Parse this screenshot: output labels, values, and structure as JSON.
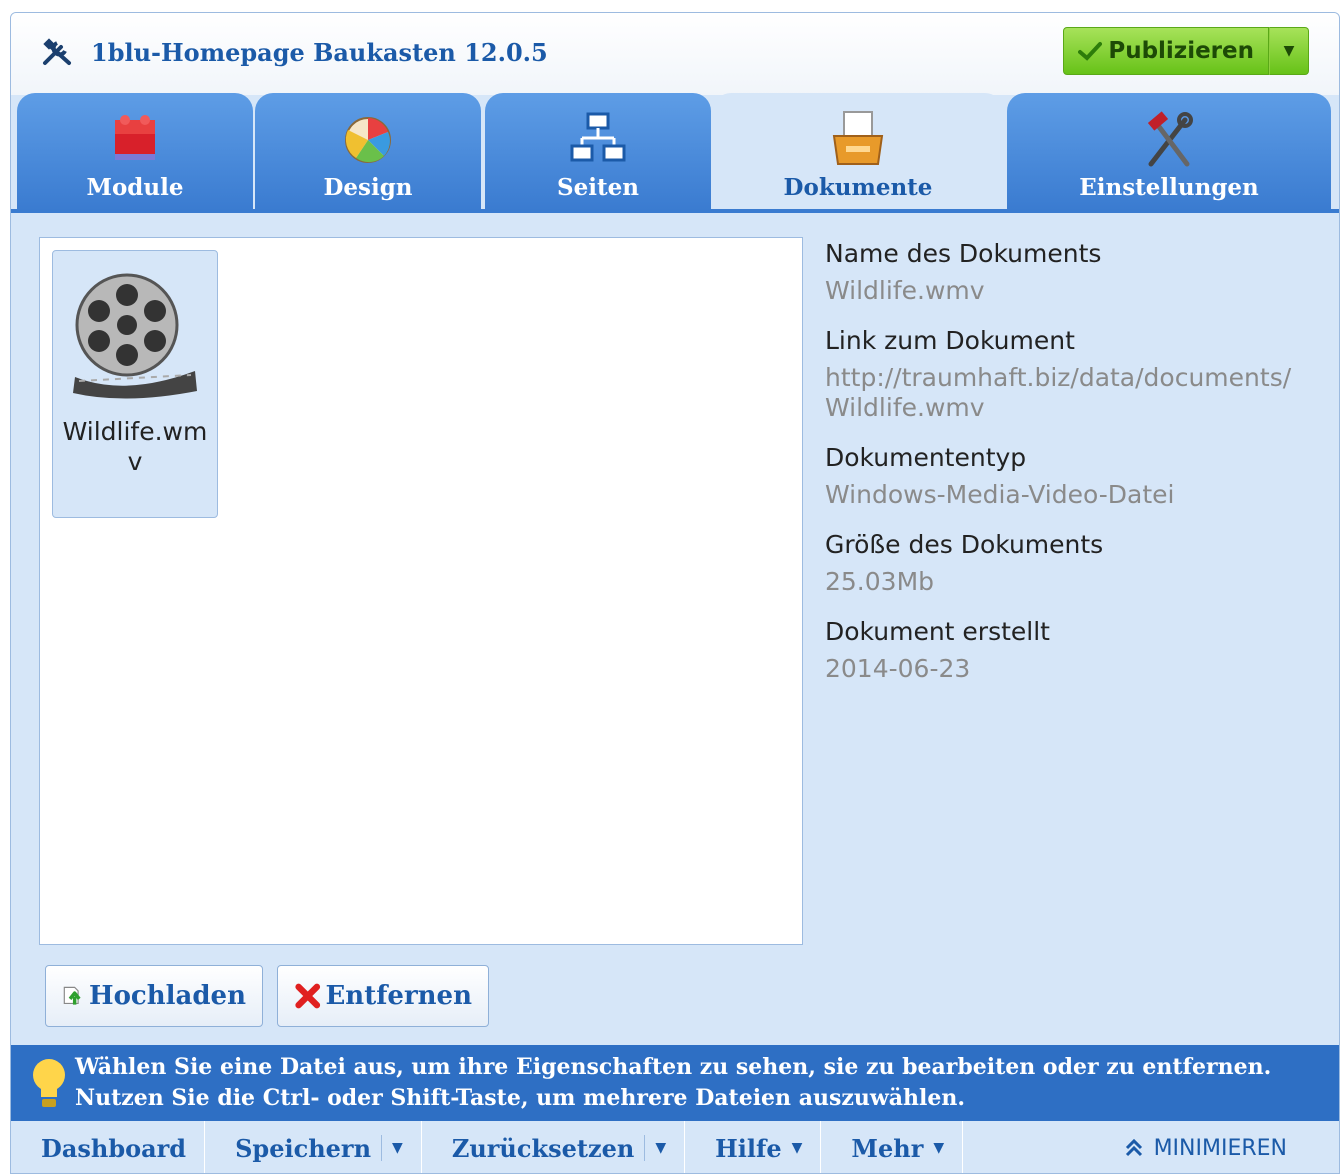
{
  "app": {
    "title": "1blu-Homepage Baukasten 12.0.5"
  },
  "publish": {
    "label": "Publizieren"
  },
  "tabs": [
    {
      "label": "Module"
    },
    {
      "label": "Design"
    },
    {
      "label": "Seiten"
    },
    {
      "label": "Dokumente"
    },
    {
      "label": "Einstellungen"
    }
  ],
  "files": [
    {
      "name": "Wildlife.wmv",
      "icon": "film-reel-icon"
    }
  ],
  "properties": {
    "name_label": "Name des Dokuments",
    "name_value": "Wildlife.wmv",
    "link_label": "Link zum Dokument",
    "link_value_1": "http://traumhaft.biz/data/documents/",
    "link_value_2": "Wildlife.wmv",
    "type_label": "Dokumententyp",
    "type_value": "Windows-Media-Video-Datei",
    "size_label": "Größe des Dokuments",
    "size_value": "25.03Mb",
    "created_label": "Dokument erstellt",
    "created_value": "2014-06-23"
  },
  "actions": {
    "upload": "Hochladen",
    "remove": "Entfernen"
  },
  "info": {
    "line1": "Wählen Sie eine Datei aus, um ihre Eigenschaften zu sehen, sie zu bearbeiten oder zu entfernen.",
    "line2": "Nutzen Sie die Ctrl- oder Shift-Taste, um mehrere Dateien auszuwählen."
  },
  "bottom": {
    "dashboard": "Dashboard",
    "save": "Speichern",
    "reset": "Zurücksetzen",
    "help": "Hilfe",
    "more": "Mehr",
    "minimize": "MINIMIEREN"
  },
  "colors": {
    "accent": "#1b5aa8",
    "tab": "#3a7bd0",
    "panel": "#d6e6f8",
    "publish": "#67c218"
  }
}
